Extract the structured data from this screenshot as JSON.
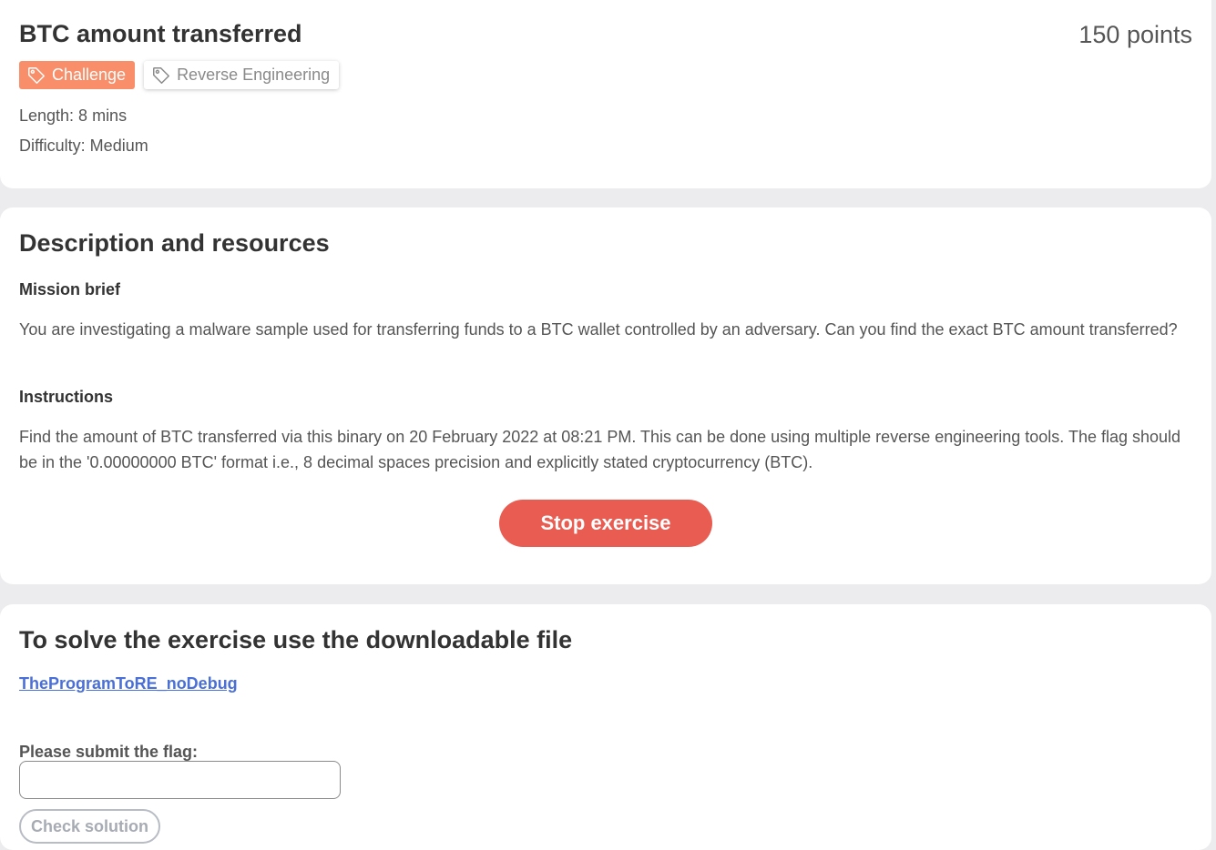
{
  "header": {
    "title": "BTC amount transferred",
    "points": "150 points",
    "tags": [
      {
        "label": "Challenge",
        "icon": "tag-icon",
        "color": "#f88f6a"
      },
      {
        "label": "Reverse Engineering",
        "icon": "tag-icon"
      }
    ],
    "length": "Length: 8 mins",
    "difficulty": "Difficulty: Medium"
  },
  "description": {
    "title": "Description and resources",
    "mission_heading": "Mission brief",
    "mission_text": "You are investigating a malware sample used for transferring funds to a BTC wallet controlled by an adversary. Can you find the exact BTC amount transferred?",
    "instructions_heading": "Instructions",
    "instructions_text": "Find the amount of BTC transferred via this binary on 20 February 2022 at 08:21 PM. This can be done using multiple reverse engineering tools. The flag should be in the '0.00000000 BTC' format i.e., 8 decimal spaces precision and explicitly stated cryptocurrency (BTC).",
    "stop_button": "Stop exercise",
    "stop_button_color": "#e95c52"
  },
  "solve": {
    "title": "To solve the exercise use the downloadable file",
    "file_link": "TheProgramToRE_noDebug",
    "flag_label": "Please submit the flag:",
    "flag_value": "",
    "check_button": "Check solution",
    "link_color": "#4a6fd6"
  }
}
